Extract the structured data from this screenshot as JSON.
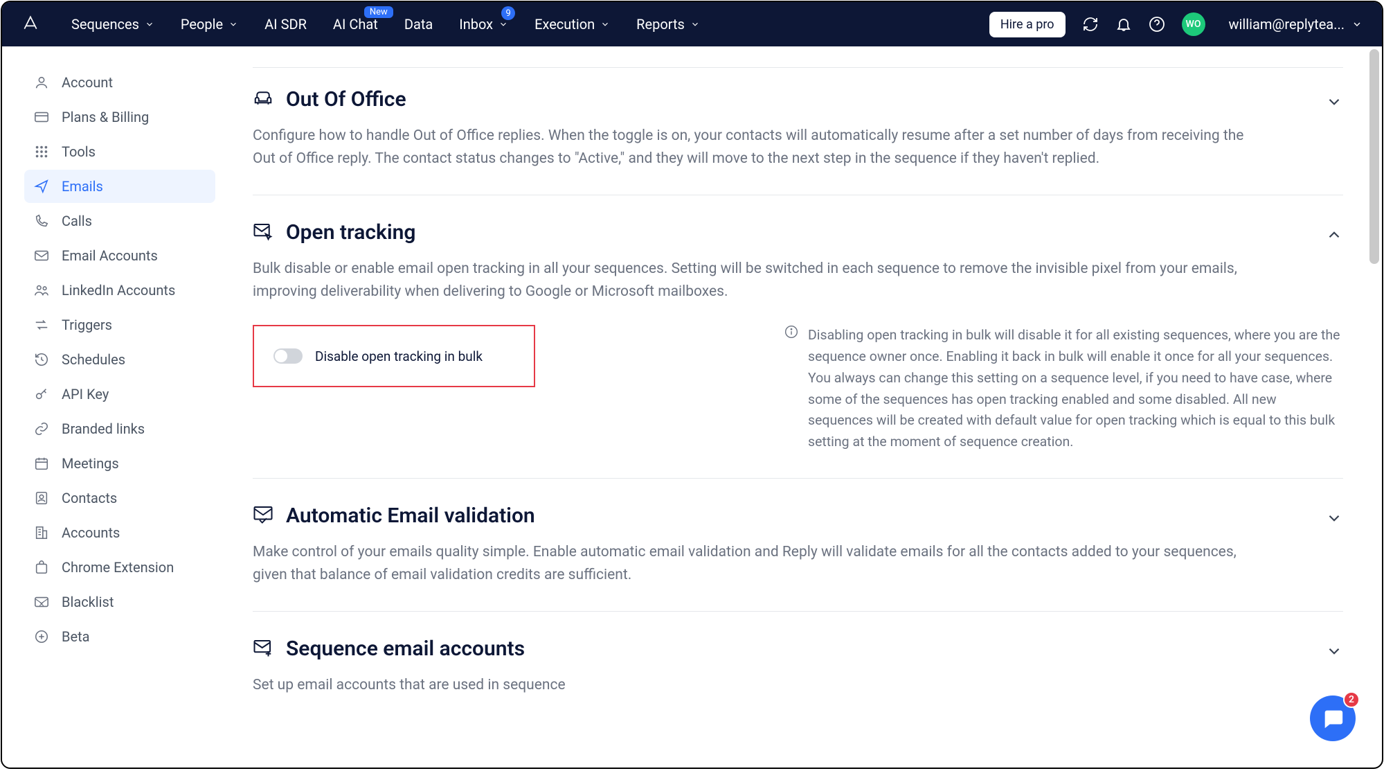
{
  "nav": {
    "items": [
      {
        "label": "Sequences",
        "has_chevron": true
      },
      {
        "label": "People",
        "has_chevron": true
      },
      {
        "label": "AI SDR",
        "has_chevron": false
      },
      {
        "label": "AI Chat",
        "has_chevron": false,
        "badge_new": "New"
      },
      {
        "label": "Data",
        "has_chevron": false
      },
      {
        "label": "Inbox",
        "has_chevron": true,
        "badge_count": "9"
      },
      {
        "label": "Execution",
        "has_chevron": true
      },
      {
        "label": "Reports",
        "has_chevron": true
      }
    ]
  },
  "topbar": {
    "hire_label": "Hire a pro",
    "avatar_initials": "WO",
    "user_email": "william@replytea..."
  },
  "sidebar": {
    "items": [
      {
        "label": "Account"
      },
      {
        "label": "Plans & Billing"
      },
      {
        "label": "Tools"
      },
      {
        "label": "Emails"
      },
      {
        "label": "Calls"
      },
      {
        "label": "Email Accounts"
      },
      {
        "label": "LinkedIn Accounts"
      },
      {
        "label": "Triggers"
      },
      {
        "label": "Schedules"
      },
      {
        "label": "API Key"
      },
      {
        "label": "Branded links"
      },
      {
        "label": "Meetings"
      },
      {
        "label": "Contacts"
      },
      {
        "label": "Accounts"
      },
      {
        "label": "Chrome Extension"
      },
      {
        "label": "Blacklist"
      },
      {
        "label": "Beta"
      }
    ]
  },
  "sections": {
    "ooo": {
      "title": "Out Of Office",
      "desc": "Configure how to handle Out of Office replies. When the toggle is on, your contacts will automatically resume after a set number of days from receiving the Out of Office reply. The contact status changes to \"Active,\" and they will move to the next step in the sequence if they haven't replied."
    },
    "open": {
      "title": "Open tracking",
      "desc": "Bulk disable or enable email open tracking in all your sequences. Setting will be switched in each sequence to remove the invisible pixel from your emails, improving deliverability when delivering to Google or Microsoft mailboxes.",
      "toggle_label": "Disable open tracking in bulk",
      "info": "Disabling open tracking in bulk will disable it for all existing sequences, where you are the sequence owner once. Enabling it back in bulk will enable it once for all your sequences. You always can change this setting on a sequence level, if you need to have case, where some of the sequences has open tracking enabled and some disabled. All new sequences will be created with default value for open tracking which is equal to this bulk setting at the moment of sequence creation."
    },
    "validation": {
      "title": "Automatic Email validation",
      "desc": "Make control of your emails quality simple. Enable automatic email validation and Reply will validate emails for all the contacts added to your sequences, given that balance of email validation credits are sufficient."
    },
    "seqaccounts": {
      "title": "Sequence email accounts",
      "desc": "Set up email accounts that are used in sequence"
    }
  },
  "chat": {
    "badge": "2"
  }
}
